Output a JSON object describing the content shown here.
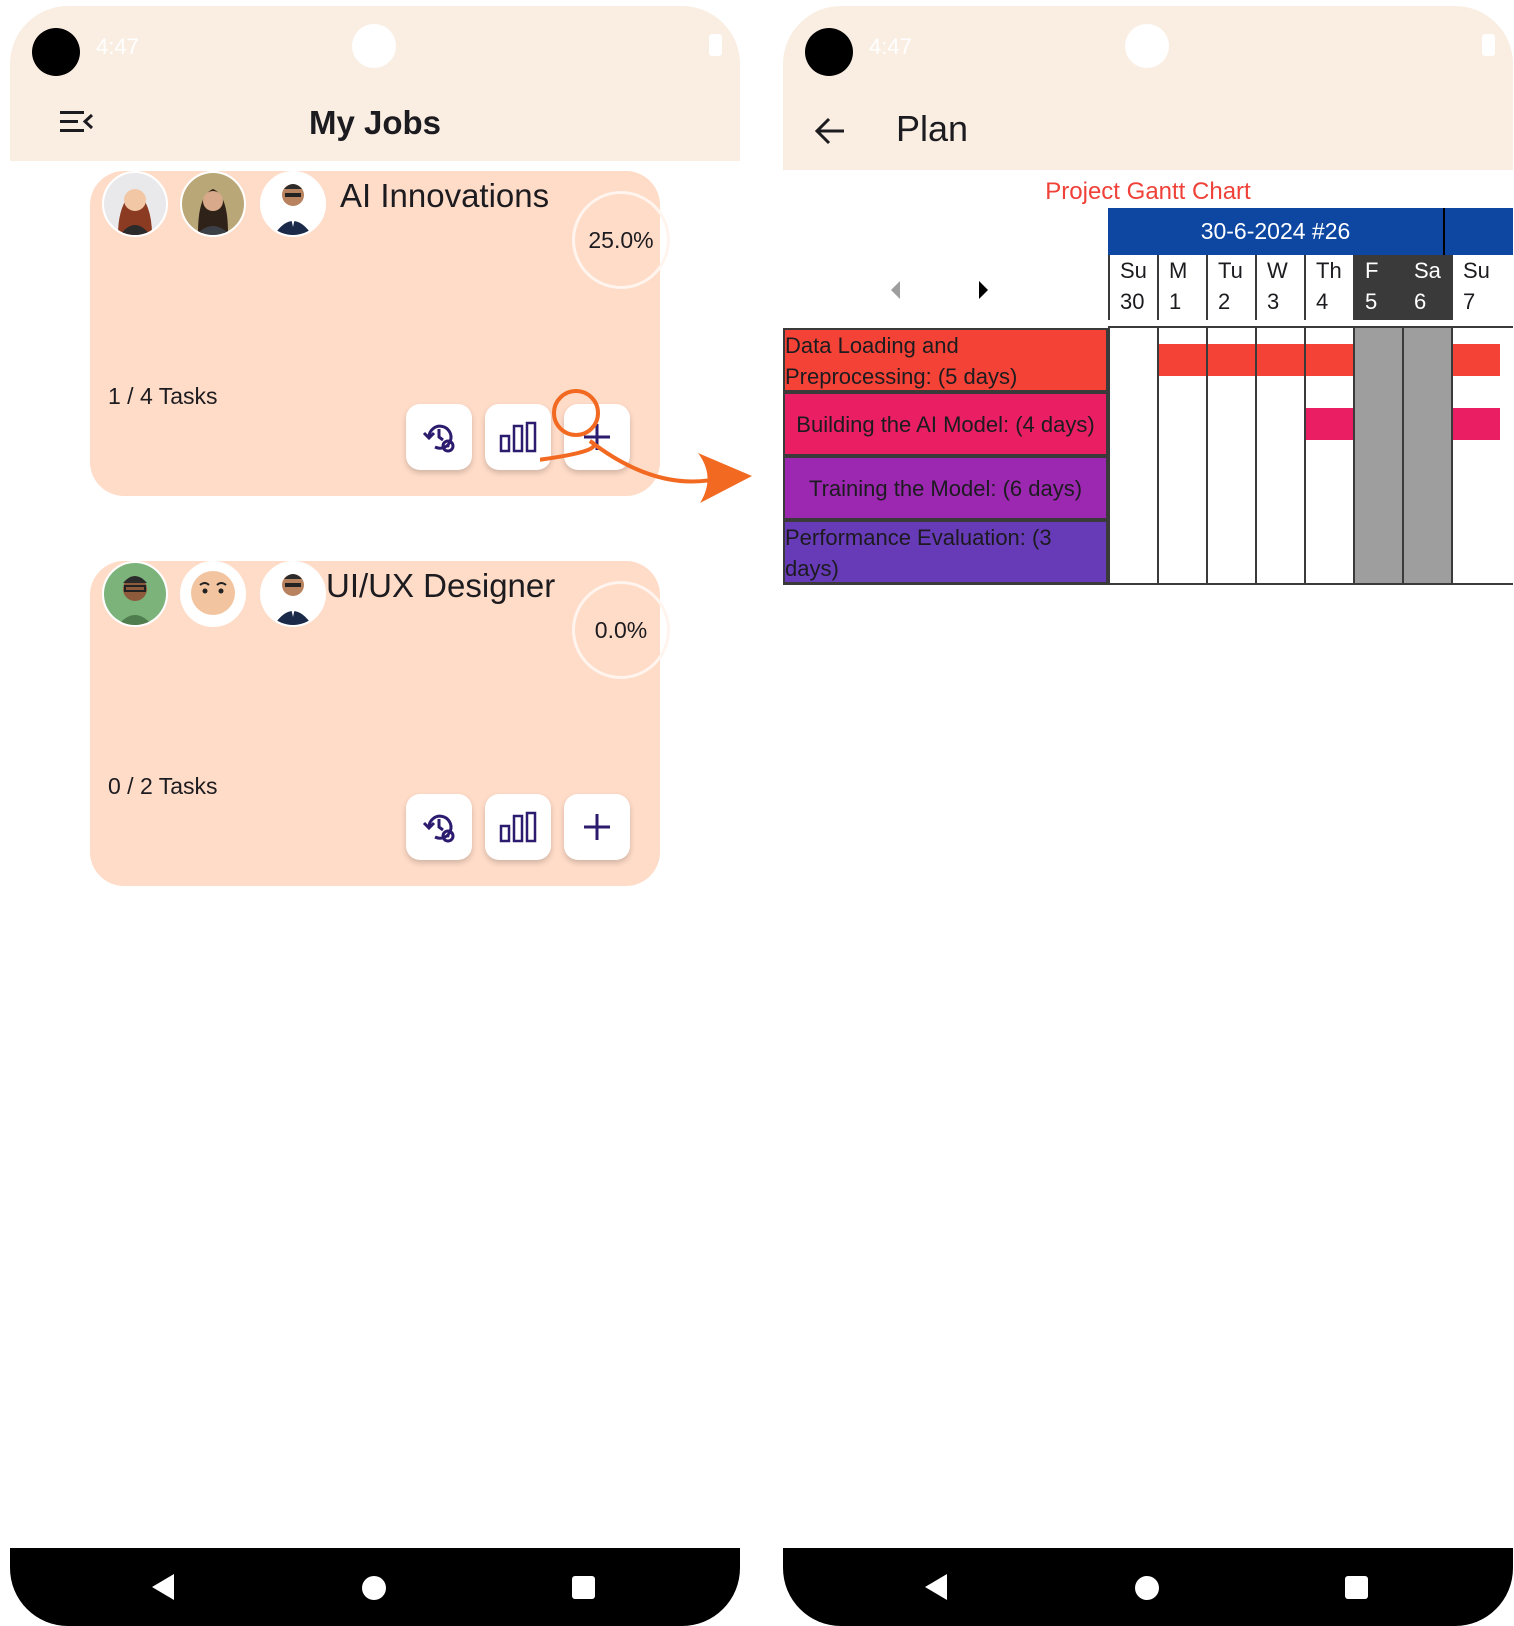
{
  "left_screen": {
    "status": {
      "time": "4:47"
    },
    "app_bar": {
      "title": "My Jobs",
      "menu_icon": "menu-open-icon"
    },
    "jobs": [
      {
        "title": "AI Innovations",
        "progress": "25.0%",
        "progress_value": 0.25,
        "tasks": "1 / 4 Tasks",
        "avatars": [
          "avatar-woman-red-hair",
          "avatar-woman-dark-hair",
          "avatar-man-suit"
        ]
      },
      {
        "title": "UI/UX Designer",
        "progress": "0.0%",
        "progress_value": 0.0,
        "tasks": "0 / 2 Tasks",
        "avatars": [
          "avatar-man-glasses",
          "avatar-man-bald",
          "avatar-man-suit"
        ]
      }
    ],
    "card_actions": [
      "history-settings-icon",
      "bar-chart-icon",
      "add-icon"
    ]
  },
  "right_screen": {
    "status": {
      "time": "4:47"
    },
    "app_bar": {
      "title": "Plan",
      "back_icon": "arrow-back-icon"
    },
    "chart_title": "Project Gantt Chart",
    "week_label": "30-6-2024  #26",
    "days": [
      {
        "name": "Su",
        "num": "30",
        "weekend": false
      },
      {
        "name": "M",
        "num": "1",
        "weekend": false
      },
      {
        "name": "Tu",
        "num": "2",
        "weekend": false
      },
      {
        "name": "W",
        "num": "3",
        "weekend": false
      },
      {
        "name": "Th",
        "num": "4",
        "weekend": false
      },
      {
        "name": "F",
        "num": "5",
        "weekend": true
      },
      {
        "name": "Sa",
        "num": "6",
        "weekend": true
      },
      {
        "name": "Su",
        "num": "7",
        "weekend": false
      }
    ],
    "tasks": [
      {
        "line1": "Data Loading and",
        "line2": "Preprocessing: (5 days)",
        "color": "#f44336"
      },
      {
        "line1": "Building the AI Model: (4 days)",
        "line2": "",
        "color": "#e91e63"
      },
      {
        "line1": "Training the Model: (6 days)",
        "line2": "",
        "color": "#9c27b0"
      },
      {
        "line1": "Performance Evaluation: (3",
        "line2": "days)",
        "color": "#673ab7"
      }
    ]
  },
  "chart_data": {
    "type": "gantt",
    "title": "Project Gantt Chart",
    "week": "30-6-2024  #26",
    "x": [
      "Su 30",
      "M 1",
      "Tu 2",
      "W 3",
      "Th 4",
      "F 5",
      "Sa 6",
      "Su 7"
    ],
    "weekend_days": [
      "F 5",
      "Sa 6"
    ],
    "series": [
      {
        "name": "Data Loading and Preprocessing: (5 days)",
        "color": "#f44336",
        "active_days": [
          "M 1",
          "Tu 2",
          "W 3",
          "Th 4",
          "Su 7"
        ]
      },
      {
        "name": "Building the AI Model: (4 days)",
        "color": "#e91e63",
        "active_days": [
          "Th 4",
          "Su 7"
        ]
      },
      {
        "name": "Training the Model: (6 days)",
        "color": "#9c27b0",
        "active_days": []
      },
      {
        "name": "Performance Evaluation: (3 days)",
        "color": "#673ab7",
        "active_days": []
      }
    ]
  },
  "annotation": {
    "color": "#f26a21"
  },
  "system_nav": {
    "back": "nav-back-icon",
    "home": "nav-home-icon",
    "recents": "nav-recents-icon"
  }
}
